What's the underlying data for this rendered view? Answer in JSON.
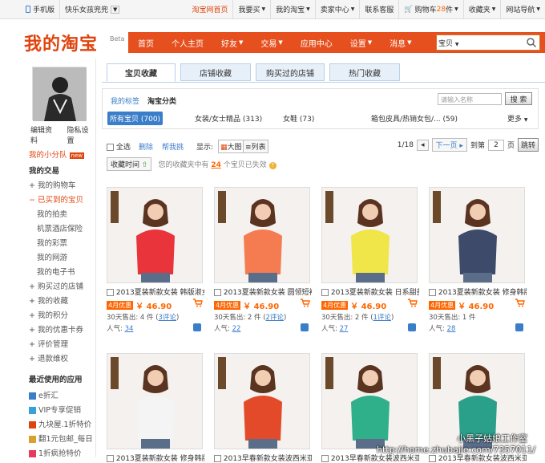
{
  "topbar": {
    "mobile": "手机版",
    "user": "快乐女孩兜兜",
    "taobao_home": "淘宝网首页",
    "buy": "我要买",
    "my_taobao": "我的淘宝",
    "seller": "卖家中心",
    "service": "联系客服",
    "cart_label": "购物车",
    "cart_count": "28",
    "cart_unit": "件",
    "favorites": "收藏夹",
    "sitemap": "网站导航"
  },
  "header": {
    "logo": "我的淘宝",
    "beta": "Beta",
    "nav": [
      "首页",
      "个人主页",
      "好友",
      "交易",
      "应用中心",
      "设置",
      "消息"
    ],
    "search_scope": "宝贝"
  },
  "sidebar": {
    "avatar_links": [
      "编辑资料",
      "隐私设置"
    ],
    "team": "我的小分队",
    "team_badge": "new",
    "trade": "我的交易",
    "items": [
      "我的购物车",
      "已买到的宝贝",
      "我的拍卖",
      "机票酒店保险",
      "我的彩票",
      "我的网游",
      "我的电子书",
      "购买过的店铺",
      "我的收藏",
      "我的积分",
      "我的优惠卡券",
      "评价管理",
      "退款维权"
    ],
    "recent_apps_title": "最近使用的应用",
    "recent_apps": [
      "e折汇",
      "VIP专享促销",
      "九块屋.1折特价",
      "翻1元包邮_每日",
      "1折疯抢特价"
    ]
  },
  "tabs": [
    "宝贝收藏",
    "店铺收藏",
    "购买过的店铺",
    "热门收藏"
  ],
  "filter": {
    "subtabs": [
      "我的标签",
      "淘宝分类"
    ],
    "search_placeholder": "请输入名称",
    "search_button": "搜 索",
    "categories": [
      {
        "label": "所有宝贝 (700)"
      },
      {
        "label": "女装/女士精品 (313)"
      },
      {
        "label": "女鞋 (73)"
      },
      {
        "label": "箱包皮具/热销女包/... (59)"
      }
    ],
    "more": "更多"
  },
  "toolbar": {
    "select_all": "全选",
    "delete": "删除",
    "share": "帮我挑",
    "display_label": "显示:",
    "large": "大图",
    "list": "列表",
    "page_info": "1/18",
    "next": "下一页",
    "goto": "到第",
    "page_value": "2",
    "page_unit": "页",
    "jump": "跳转"
  },
  "sort": {
    "by_time": "收藏时间",
    "notice_pre": "您的收藏夹中有",
    "notice_count": "24",
    "notice_post": "个宝贝已失效"
  },
  "products": [
    {
      "title": "2013夏装新款女装 韩版淑女",
      "tag": "4月优惠",
      "price": "￥ 46.90",
      "sold_pre": "30天售出: 4 件 (",
      "reviews": "3评论",
      "sold_post": ")",
      "pop_label": "人气:",
      "pop": "34",
      "shirt": "#e8343a"
    },
    {
      "title": "2013夏装新款女装 圆领短袖",
      "tag": "4月优惠",
      "price": "￥ 46.90",
      "sold_pre": "30天售出: 2 件 (",
      "reviews": "2评论",
      "sold_post": ")",
      "pop_label": "人气:",
      "pop": "22",
      "shirt": "#f47c50"
    },
    {
      "title": "2013夏装新款女装 日系甜美",
      "tag": "4月优惠",
      "price": "￥ 46.90",
      "sold_pre": "30天售出: 2 件 (",
      "reviews": "1评论",
      "sold_post": ")",
      "pop_label": "人气:",
      "pop": "27",
      "shirt": "#f0e64a"
    },
    {
      "title": "2013夏装新款女装 修身韩版",
      "tag": "4月优惠",
      "price": "￥ 46.90",
      "sold_pre": "30天售出: 1 件",
      "reviews": "",
      "sold_post": "",
      "pop_label": "人气:",
      "pop": "28",
      "shirt": "#3d4a6a"
    },
    {
      "title": "2013夏装新款女装 修身韩版",
      "shirt": "#f4f4f4"
    },
    {
      "title": "2013早春新款女装波西米亚",
      "shirt": "#e34a2a"
    },
    {
      "title": "2013早春新款女装波西米亚",
      "shirt": "#2fb08a"
    },
    {
      "title": "2013早春新款女装波西米亚",
      "shirt": "#2aa08a"
    }
  ],
  "watermark": {
    "line1": "小黑子姑娘工作室",
    "line2": "http://home.zhubajie.com/7357011/"
  }
}
